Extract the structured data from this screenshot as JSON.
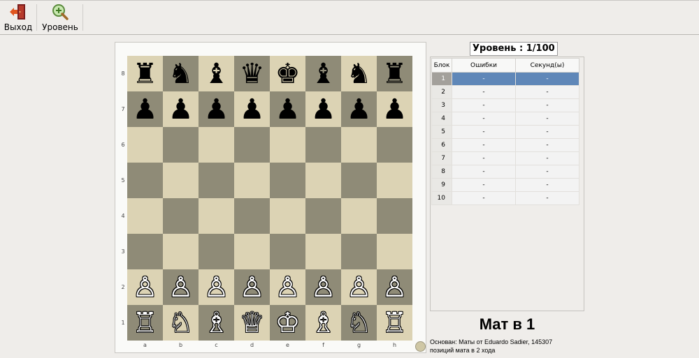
{
  "toolbar": {
    "exit_label": "Выход",
    "level_label": "Уровень",
    "exit_icon": "exit-door-icon",
    "level_icon": "zoom-in-icon"
  },
  "board": {
    "light_color": "#dcd3b4",
    "dark_color": "#8f8b77",
    "files": [
      "a",
      "b",
      "c",
      "d",
      "e",
      "f",
      "g",
      "h"
    ],
    "ranks": [
      "8",
      "7",
      "6",
      "5",
      "4",
      "3",
      "2",
      "1"
    ],
    "position": [
      [
        "♜",
        "♞",
        "♝",
        "♛",
        "♚",
        "♝",
        "♞",
        "♜"
      ],
      [
        "♟",
        "♟",
        "♟",
        "♟",
        "♟",
        "♟",
        "♟",
        "♟"
      ],
      [
        "",
        "",
        "",
        "",
        "",
        "",
        "",
        ""
      ],
      [
        "",
        "",
        "",
        "",
        "",
        "",
        "",
        ""
      ],
      [
        "",
        "",
        "",
        "",
        "",
        "",
        "",
        ""
      ],
      [
        "",
        "",
        "",
        "",
        "",
        "",
        "",
        ""
      ],
      [
        "♙",
        "♙",
        "♙",
        "♙",
        "♙",
        "♙",
        "♙",
        "♙"
      ],
      [
        "♖",
        "♘",
        "♗",
        "♕",
        "♔",
        "♗",
        "♘",
        "♖"
      ]
    ]
  },
  "level_title": "Уровень : 1/100",
  "table": {
    "headers": [
      "Блок",
      "Ошибки",
      "Секунд(ы)"
    ],
    "selected_row": 1,
    "rows": [
      {
        "block": "1",
        "errors": "-",
        "seconds": "-"
      },
      {
        "block": "2",
        "errors": "-",
        "seconds": "-"
      },
      {
        "block": "3",
        "errors": "-",
        "seconds": "-"
      },
      {
        "block": "4",
        "errors": "-",
        "seconds": "-"
      },
      {
        "block": "5",
        "errors": "-",
        "seconds": "-"
      },
      {
        "block": "6",
        "errors": "-",
        "seconds": "-"
      },
      {
        "block": "7",
        "errors": "-",
        "seconds": "-"
      },
      {
        "block": "8",
        "errors": "-",
        "seconds": "-"
      },
      {
        "block": "9",
        "errors": "-",
        "seconds": "-"
      },
      {
        "block": "10",
        "errors": "-",
        "seconds": "-"
      }
    ]
  },
  "mate_title": "Мат в 1",
  "source_line1": "Основан: Маты от Eduardo Sadier, 145307",
  "source_line2": "позиций мата в 2 хода"
}
